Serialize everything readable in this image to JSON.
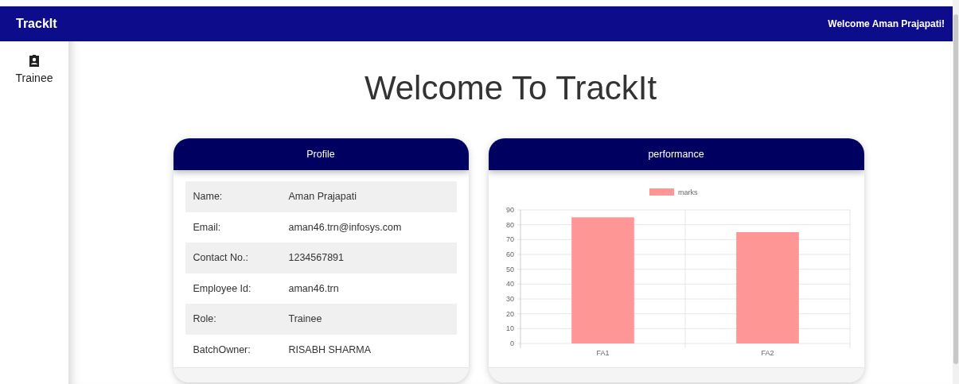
{
  "app_bar": {
    "title": "TrackIt",
    "welcome": "Welcome Aman Prajapati!"
  },
  "sidebar": {
    "items": [
      {
        "label": "Trainee",
        "selected": false
      }
    ]
  },
  "heading": "Welcome To TrackIt",
  "profile": {
    "title": "Profile",
    "rows": [
      {
        "label": "Name:",
        "value": "Aman Prajapati"
      },
      {
        "label": "Email:",
        "value": "aman46.trn@infosys.com"
      },
      {
        "label": "Contact No.:",
        "value": "1234567891"
      },
      {
        "label": "Employee Id:",
        "value": "aman46.trn"
      },
      {
        "label": "Role:",
        "value": "Trainee"
      },
      {
        "label": "BatchOwner:",
        "value": "RISABH SHARMA"
      }
    ]
  },
  "performance": {
    "title": "performance",
    "chart_data": {
      "type": "bar",
      "categories": [
        "FA1",
        "FA2"
      ],
      "series": [
        {
          "name": "marks",
          "color": "#ff9696",
          "values": [
            85,
            75
          ]
        }
      ],
      "ylim": [
        0,
        90
      ],
      "grid": true,
      "yticks": [
        0,
        10,
        20,
        30,
        40,
        50,
        60,
        70,
        80,
        90
      ]
    }
  }
}
